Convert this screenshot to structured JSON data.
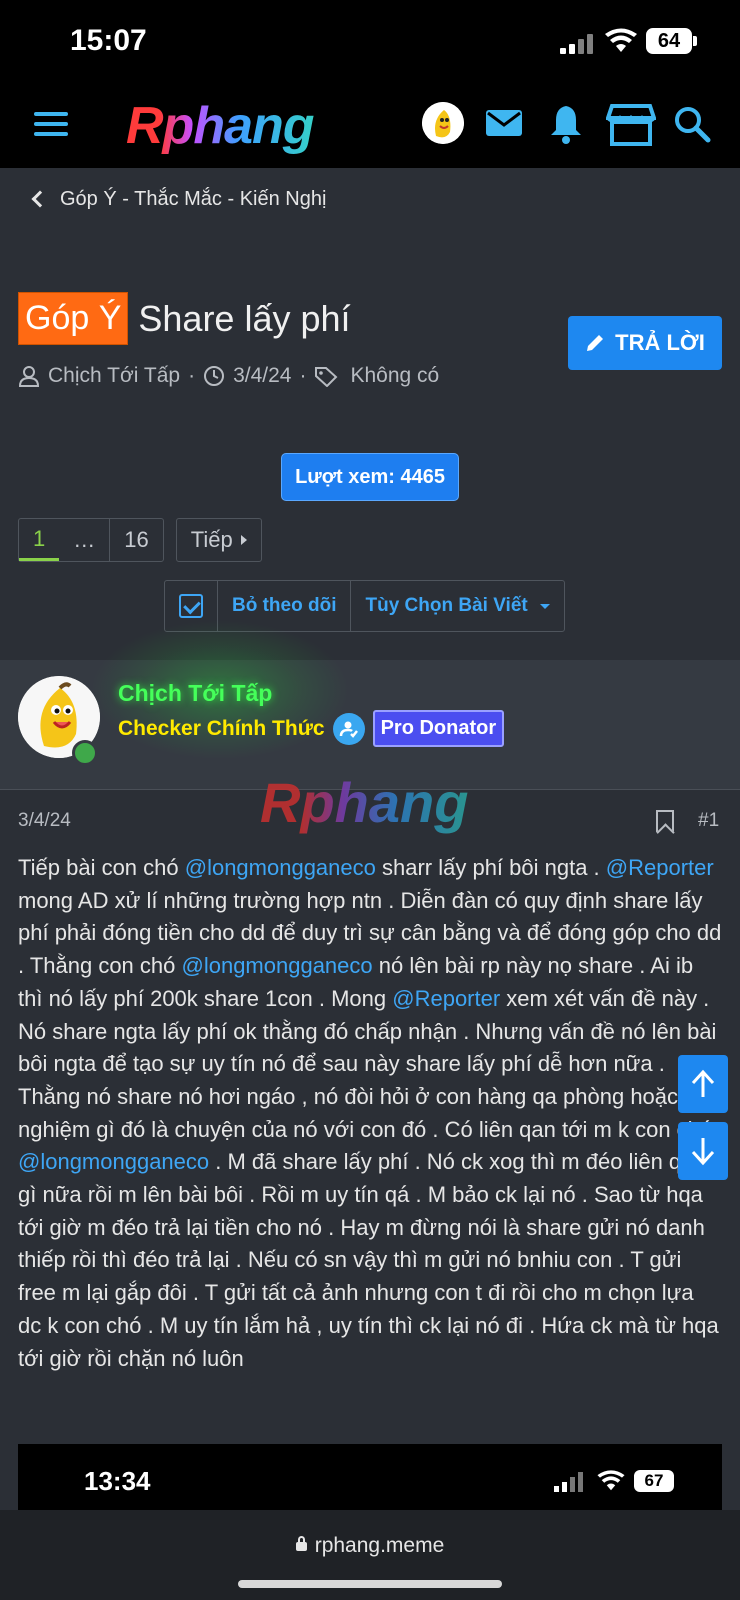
{
  "status_bar": {
    "time": "15:07",
    "battery": "64"
  },
  "navbar": {
    "logo": "Rphang"
  },
  "breadcrumb": {
    "label": "Góp Ý - Thắc Mắc - Kiến Nghị"
  },
  "thread": {
    "prefix": "Góp Ý",
    "title": "Share lấy phí",
    "reply_label": "TRẢ LỜI",
    "author": "Chịch Tới Tấp",
    "date": "3/4/24",
    "tags": "Không có",
    "sep": "·"
  },
  "views": "Lượt xem: 4465",
  "pagination": {
    "current": "1",
    "ellipsis": "…",
    "last": "16",
    "next": "Tiếp"
  },
  "options": {
    "unwatch": "Bỏ theo dõi",
    "thread_tools": "Tùy Chọn Bài Viết"
  },
  "post": {
    "author_name": "Chịch Tới Tấp",
    "author_title": "Checker Chính Thức",
    "badge": "Pro Donator",
    "watermark": "Rphang",
    "date": "3/4/24",
    "number": "#1",
    "body": {
      "t1": "Tiếp bài con chó ",
      "m1": "@longmongganeco",
      "t2": " sharr lấy phí bôi ngta . ",
      "m2": "@Reporter",
      "t3": " mong AD xử lí những trường hợp ntn . Diễn đàn có quy định share lấy phí phải đóng tiền cho dd để duy trì sự cân bằng và để đóng góp cho dd . Thằng con chó ",
      "m3": "@longmongganeco",
      "t4": " nó lên bài rp này nọ share . Ai ib thì nó lấy phí 200k share 1con . Mong ",
      "m4": "@Reporter",
      "t5": " xem xét vấn đề này . Nó share ngta lấy phí ok thằng đó chấp nhận . Nhưng vấn đề nó lên bài bôi ngta để tạo sự uy tín nó để sau này share lấy phí dễ hơn nữa . Thằng nó share nó hơi ngáo , nó đòi hỏi ở con hàng qa phòng hoặc xét nghiệm gì đó là chuyện của nó với con đó . Có liên qan tới m k con chó ",
      "m5": "@longmongganeco",
      "t6": " . M đã share lấy phí . Nó ck xog thì m đéo liên qan gì nữa rồi m lên bài bôi . Rồi m uy tín qá . M bảo ck lại nó . Sao từ hqa tới giờ m đéo trả lại tiền cho nó . Hay m đừng nói là share gửi nó danh thiếp rồi thì đéo trả lại . Nếu có sn vậy thì m gửi nó bnhiu con . T gửi free m lại gắp đôi . T gửi tất cả ảnh nhưng con t đi rồi cho m chọn lựa dc k con chó . M uy tín lắm hả , uy tín thì ck lại nó đi . Hứa ck mà từ hqa tới giờ rồi chặn nó luôn"
    }
  },
  "embedded_screenshot": {
    "time": "13:34",
    "battery": "67"
  },
  "browser": {
    "url": "rphang.meme"
  }
}
